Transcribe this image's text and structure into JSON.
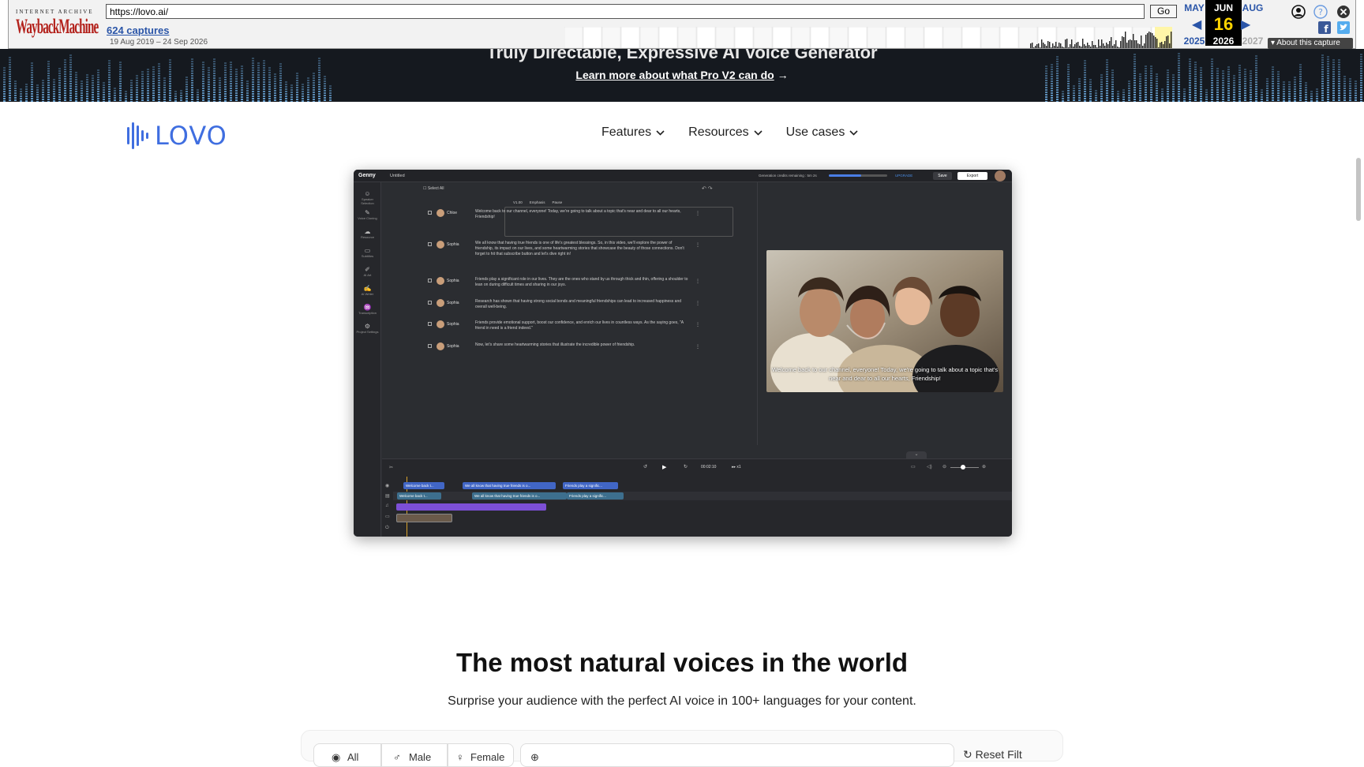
{
  "wayback": {
    "ia_label": "INTERNET ARCHIVE",
    "logo_text": "WaybackMachine",
    "url": "https://lovo.ai/",
    "go_label": "Go",
    "captures": "624 captures",
    "date_range": "19 Aug 2019 – 24 Sep 2026",
    "months": {
      "prev": "MAY",
      "current": "JUN",
      "next": "AUG"
    },
    "day": "16",
    "years": {
      "prev": "2025",
      "current": "2026",
      "next": "2027"
    },
    "about": "About this capture",
    "icons": [
      "user-icon",
      "help-icon",
      "close-icon",
      "facebook-icon",
      "twitter-icon"
    ]
  },
  "promo": {
    "title": "Truly Directable, Expressive AI Voice Generator",
    "link": "Learn more about what Pro V2 can do",
    "link_arrow": "→"
  },
  "header": {
    "logo": "LOVO",
    "nav": [
      {
        "label": "Features"
      },
      {
        "label": "Resources"
      },
      {
        "label": "Use cases"
      }
    ]
  },
  "app": {
    "brand": "Genny",
    "doc": "Untitled",
    "credits": "Generation credits remaining : 5m 2s",
    "upgrade": "UPGRADE",
    "save": "Save",
    "export": "Export",
    "select_all": "Select All",
    "toolbar": [
      "V1.00",
      "Emphasis",
      "Pause"
    ],
    "sidebar": [
      "Speaker Selection",
      "Voice Cloning",
      "Resource",
      "Subtitles",
      "AI Art",
      "AI Writer",
      "Transcription",
      "Project Settings"
    ],
    "rows": [
      {
        "speaker": "Chloe",
        "text": "Welcome back to our channel, everyone! Today, we're going to talk about a topic that's near and dear to all our hearts, Friendship!"
      },
      {
        "speaker": "Sophia",
        "text": "We all know that having true friends is one of life's greatest blessings. So, in this video, we'll explore the power of friendship, its impact on our lives, and some heartwarming stories that showcase the beauty of those connections. Don't forget to hit that subscribe button and let's dive right in!"
      },
      {
        "speaker": "Sophia",
        "text": "Friends play a significant role in our lives. They are the ones who stand by us through thick and thin, offering a shoulder to lean on during difficult times and sharing in our joys."
      },
      {
        "speaker": "Sophia",
        "text": "Research has shown that having strong social bonds and meaningful friendships can lead to increased happiness and overall well-being."
      },
      {
        "speaker": "Sophia",
        "text": "Friends provide emotional support, boost our confidence, and enrich our lives in countless ways. As the saying goes, \"A friend in need is a friend indeed.\""
      },
      {
        "speaker": "Sophia",
        "text": "Now, let's share some heartwarming stories that illustrate the incredible power of friendship."
      }
    ],
    "subtitle": "Welcome back to our channel, everyone! Today, we're going to talk about a topic that's near and dear to all our hearts, Friendship!",
    "time": "00:02:10",
    "speed": "x1",
    "clips_row1": [
      "Welcome back t...",
      "We all know that having true friends is o...",
      "Friends play a signific..."
    ],
    "clips_row2": [
      "Welcome back t...",
      "We all know that having true friends is o...",
      "Friends play a signific..."
    ]
  },
  "voices": {
    "title": "The most natural voices in the world",
    "subtitle": "Surprise your audience with the perfect AI voice in 100+ languages for your content.",
    "filters": [
      "All",
      "Male",
      "Female"
    ],
    "reset": "Reset Filt"
  },
  "colors": {
    "brand": "#3f6ee0",
    "promo_bg": "#15191f",
    "app_bg": "#2b2d31",
    "wayback_red": "#b3211b",
    "wayback_link": "#2a55a8"
  }
}
